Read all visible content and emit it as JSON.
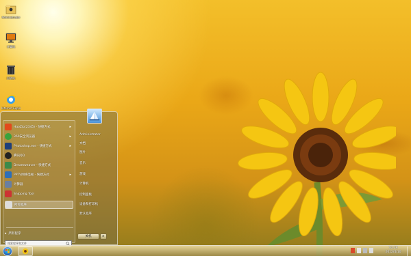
{
  "desktop": {
    "icons": [
      {
        "name": "Administrator"
      },
      {
        "name": "计算机"
      },
      {
        "name": "回收站"
      },
      {
        "name": "Internet Explorer"
      }
    ]
  },
  "start_menu": {
    "programs": [
      {
        "label": "HaoZip(2345) - 快捷方式",
        "submenu": true
      },
      {
        "label": "360安全浏览器",
        "submenu": true
      },
      {
        "label": "Photoshop.exe - 快捷方式",
        "submenu": true
      },
      {
        "label": "腾讯QQ",
        "submenu": false
      },
      {
        "label": "Dreamweaver - 快捷方式",
        "submenu": false
      },
      {
        "label": "PPTV网络电视 - 快捷方式",
        "submenu": true
      },
      {
        "label": "计算器",
        "submenu": false
      },
      {
        "label": "Snipping Tool",
        "submenu": false
      },
      {
        "label": "所有程序",
        "submenu": false
      }
    ],
    "bottom_item": "所有程序",
    "search_placeholder": "搜索程序和文件",
    "user": "Administrator",
    "right_items": [
      "Administrator",
      "文档",
      "图片",
      "音乐",
      "游戏",
      "计算机",
      "控制面板",
      "设备和打印机",
      "默认程序"
    ],
    "shutdown_label": "关机",
    "shutdown_arrow": "▸"
  },
  "taskbar": {
    "time": "10:29",
    "date": "2012/4/10"
  },
  "colors": {
    "sunflower_petal": "#f5c612",
    "sunflower_center": "#5a2c0c",
    "orb": "#2a6fc0"
  }
}
